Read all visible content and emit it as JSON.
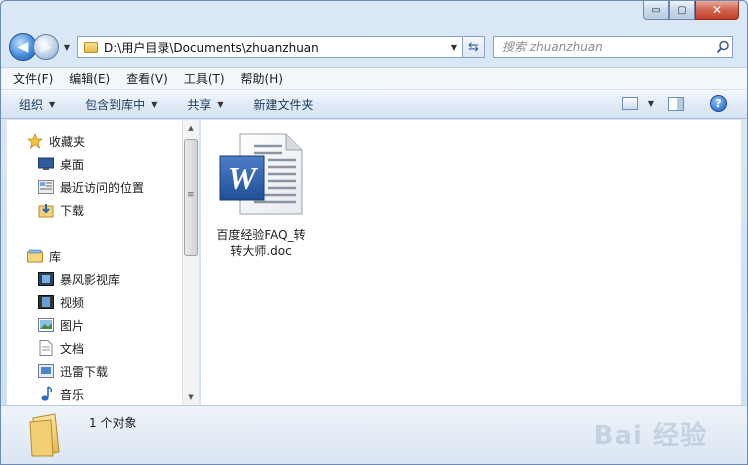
{
  "window": {
    "caption_buttons": {
      "minimize": "▭",
      "maximize": "▢",
      "close": "✕"
    }
  },
  "address": {
    "path": "D:\\用户目录\\Documents\\zhuanzhuan"
  },
  "search": {
    "placeholder": "搜索 zhuanzhuan"
  },
  "menu": {
    "items": [
      "文件(F)",
      "编辑(E)",
      "查看(V)",
      "工具(T)",
      "帮助(H)"
    ]
  },
  "toolbar": {
    "organize": "组织",
    "include_library": "包含到库中",
    "share": "共享",
    "new_folder": "新建文件夹",
    "help": "?"
  },
  "nav": {
    "favorites": "收藏夹",
    "desktop": "桌面",
    "recent": "最近访问的位置",
    "downloads": "下载",
    "libraries": "库",
    "baofeng": "暴风影视库",
    "videos": "视频",
    "pictures": "图片",
    "documents": "文档",
    "xunlei": "迅雷下载",
    "music": "音乐"
  },
  "files": [
    {
      "name": "百度经验FAQ_转转大师.doc",
      "icon": "word-doc-icon"
    }
  ],
  "status": {
    "count": "1 个对象"
  },
  "watermark": "Bai 经验"
}
